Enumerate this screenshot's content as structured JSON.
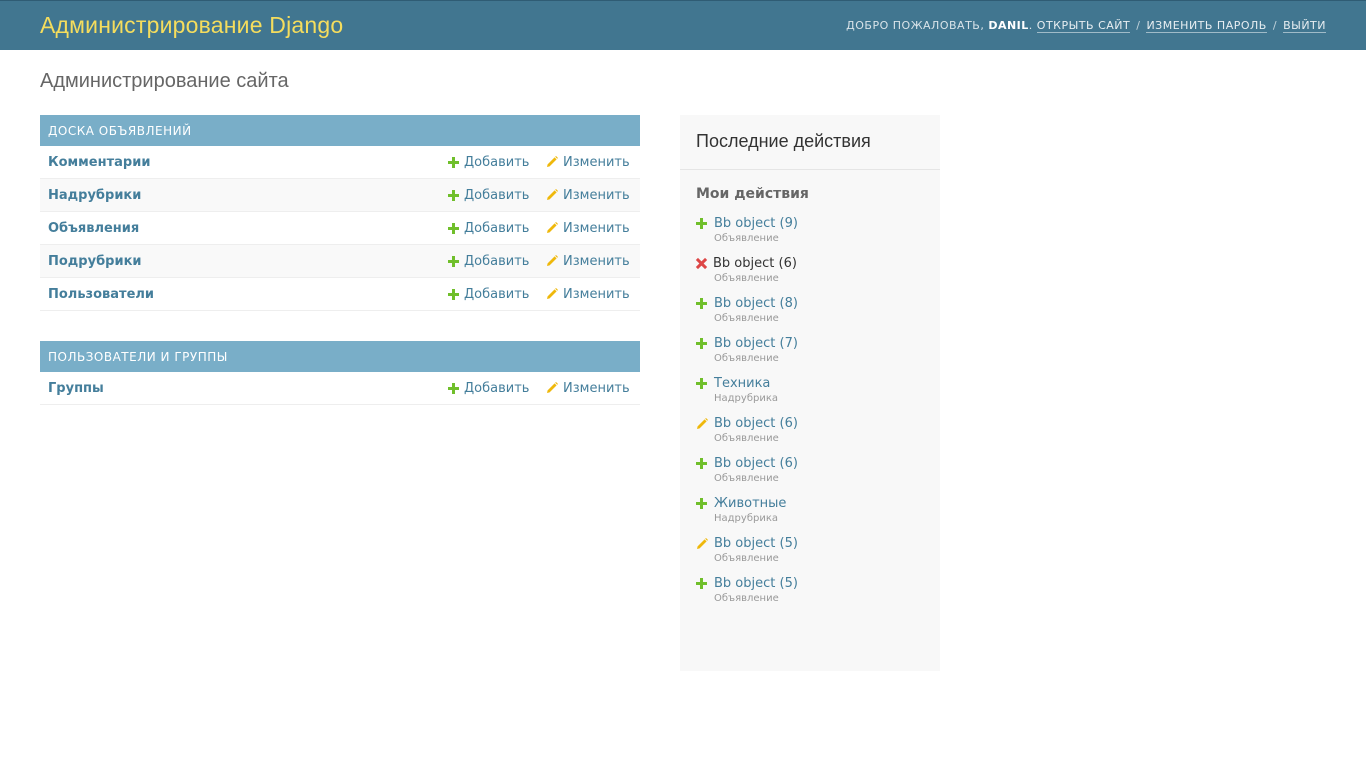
{
  "header": {
    "branding": "Администрирование Django",
    "welcome": "Добро пожаловать,",
    "username": "DANIL",
    "view_site": "Открыть сайт",
    "change_password": "Изменить пароль",
    "logout": "Выйти",
    "separator": "/"
  },
  "page_title": "Администрирование сайта",
  "apps": [
    {
      "caption": "Доска объявлений",
      "models": [
        {
          "name": "Комментарии",
          "add": "Добавить",
          "change": "Изменить"
        },
        {
          "name": "Надрубрики",
          "add": "Добавить",
          "change": "Изменить"
        },
        {
          "name": "Объявления",
          "add": "Добавить",
          "change": "Изменить"
        },
        {
          "name": "Подрубрики",
          "add": "Добавить",
          "change": "Изменить"
        },
        {
          "name": "Пользователи",
          "add": "Добавить",
          "change": "Изменить"
        }
      ]
    },
    {
      "caption": "Пользователи и группы",
      "models": [
        {
          "name": "Группы",
          "add": "Добавить",
          "change": "Изменить"
        }
      ]
    }
  ],
  "recent_actions": {
    "title": "Последние действия",
    "subtitle": "Мои действия",
    "items": [
      {
        "kind": "add",
        "text": "Bb object (9)",
        "type": "Объявление"
      },
      {
        "kind": "delete",
        "text": "Bb object (6)",
        "type": "Объявление"
      },
      {
        "kind": "add",
        "text": "Bb object (8)",
        "type": "Объявление"
      },
      {
        "kind": "add",
        "text": "Bb object (7)",
        "type": "Объявление"
      },
      {
        "kind": "add",
        "text": "Техника",
        "type": "Надрубрика"
      },
      {
        "kind": "change",
        "text": "Bb object (6)",
        "type": "Объявление"
      },
      {
        "kind": "add",
        "text": "Bb object (6)",
        "type": "Объявление"
      },
      {
        "kind": "add",
        "text": "Животные",
        "type": "Надрубрика"
      },
      {
        "kind": "change",
        "text": "Bb object (5)",
        "type": "Объявление"
      },
      {
        "kind": "add",
        "text": "Bb object (5)",
        "type": "Объявление"
      }
    ]
  },
  "colors": {
    "header_bg": "#417690",
    "branding": "#f5dd5d",
    "caption_bg": "#79aec8",
    "link": "#447e9b",
    "add_icon": "#70bf2b",
    "change_icon": "#efb80b",
    "delete_icon": "#dd4646"
  }
}
